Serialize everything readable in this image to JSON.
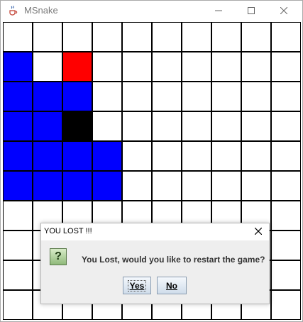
{
  "window": {
    "title": "MSnake",
    "icon": "java-cup-icon",
    "controls": [
      "minimize-icon",
      "maximize-icon",
      "close-icon"
    ]
  },
  "board": {
    "cols": 10,
    "rows": 10,
    "colors": {
      "empty": "#ffffff",
      "snake": "#0000ff",
      "food": "#ff0000",
      "head": "#000000",
      "grid": "#000000"
    },
    "snake_cells": [
      [
        0,
        1
      ],
      [
        0,
        2
      ],
      [
        1,
        2
      ],
      [
        2,
        2
      ],
      [
        0,
        3
      ],
      [
        1,
        3
      ],
      [
        0,
        4
      ],
      [
        1,
        4
      ],
      [
        2,
        4
      ],
      [
        3,
        4
      ],
      [
        0,
        5
      ],
      [
        1,
        5
      ],
      [
        2,
        5
      ],
      [
        3,
        5
      ]
    ],
    "food_cells": [
      [
        2,
        1
      ]
    ],
    "head_cells": [
      [
        2,
        3
      ]
    ]
  },
  "dialog": {
    "title": "YOU LOST !!!",
    "message": "You Lost, would you like to restart the game?",
    "icon": "question-icon",
    "icon_glyph": "?",
    "yes_label": "Yes",
    "no_label": "No"
  }
}
